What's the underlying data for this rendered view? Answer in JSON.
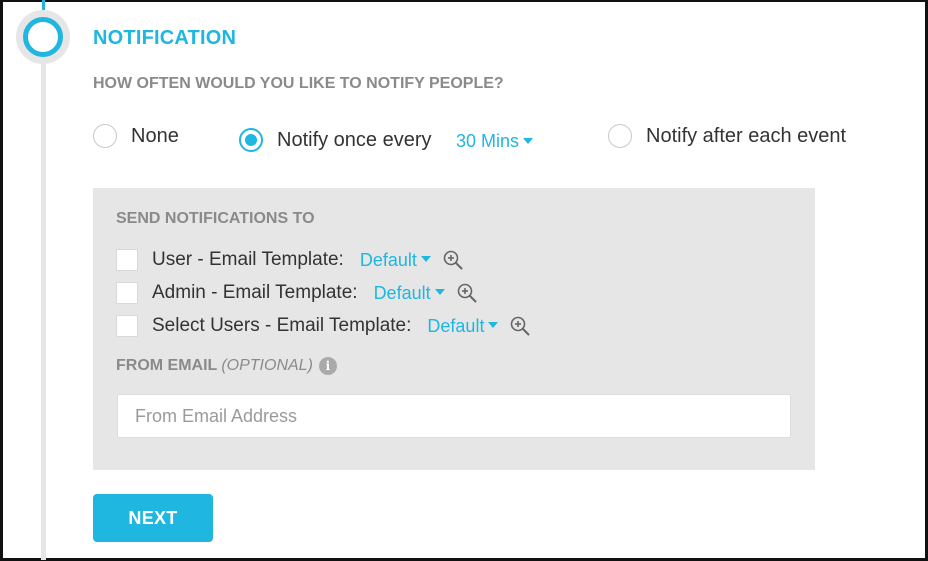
{
  "section": {
    "title": "NOTIFICATION",
    "question": "HOW OFTEN WOULD YOU LIKE TO NOTIFY PEOPLE?"
  },
  "frequency": {
    "options": [
      {
        "label": "None",
        "selected": false
      },
      {
        "label": "Notify once every",
        "selected": true
      },
      {
        "label": "Notify after each event",
        "selected": false
      }
    ],
    "interval_value": "30 Mins"
  },
  "send_to": {
    "heading": "SEND NOTIFICATIONS TO",
    "rows": [
      {
        "label": "User - Email Template:",
        "template": "Default",
        "checked": false
      },
      {
        "label": "Admin - Email Template:",
        "template": "Default",
        "checked": false
      },
      {
        "label": "Select Users - Email Template:",
        "template": "Default",
        "checked": false
      }
    ],
    "preview_icon": "zoom-in-icon"
  },
  "from_email": {
    "label": "FROM EMAIL",
    "optional": "(OPTIONAL)",
    "info_icon": "info-icon",
    "info_glyph": "i",
    "placeholder": "From Email Address",
    "value": ""
  },
  "actions": {
    "next_label": "NEXT"
  },
  "colors": {
    "accent": "#1fb6e0",
    "panel_bg": "#e6e6e6",
    "muted_text": "#8a8a8a"
  }
}
